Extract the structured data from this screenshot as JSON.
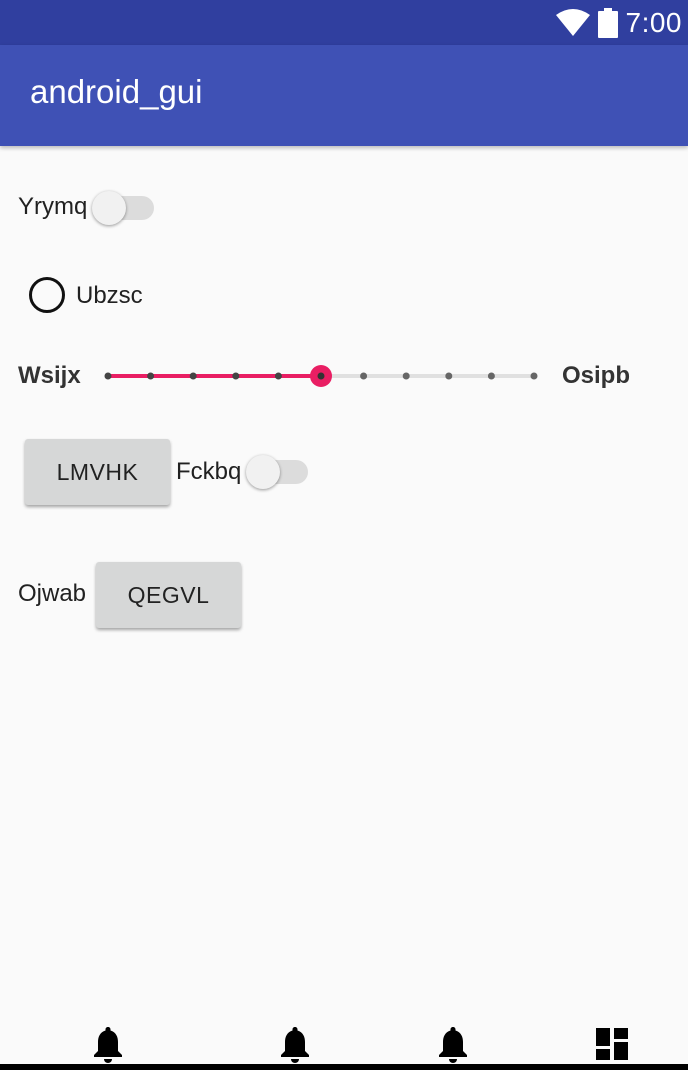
{
  "status_bar": {
    "time": "7:00",
    "icons": [
      "wifi-icon",
      "battery-icon"
    ]
  },
  "app_bar": {
    "title": "android_gui"
  },
  "switch1": {
    "label": "Yrymq",
    "checked": false
  },
  "radio1": {
    "label": "Ubzsc",
    "checked": false
  },
  "slider": {
    "left_label": "Wsijx",
    "right_label": "Osipb",
    "value": 5,
    "max": 10,
    "accent": "#e91e63"
  },
  "button1": {
    "label": "LMVHK"
  },
  "switch2": {
    "label": "Fckbq",
    "checked": false
  },
  "row3": {
    "label": "Ojwab",
    "button_label": "QEGVL"
  },
  "bottom_nav": {
    "icons": [
      "bell-icon",
      "bell-icon",
      "bell-icon",
      "dashboard-icon"
    ]
  },
  "colors": {
    "status_bar": "#303f9f",
    "app_bar": "#3f51b5",
    "background": "#fafafa"
  }
}
